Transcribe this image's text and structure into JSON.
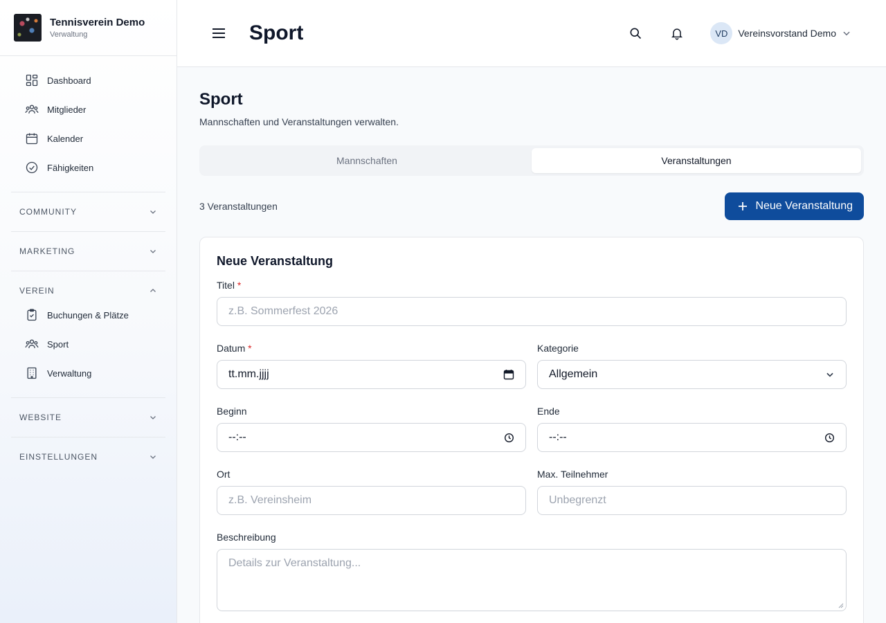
{
  "brand": {
    "title": "Tennisverein Demo",
    "subtitle": "Verwaltung"
  },
  "sidebar": {
    "main_items": [
      {
        "label": "Dashboard",
        "icon": "dashboard-icon"
      },
      {
        "label": "Mitglieder",
        "icon": "users-icon"
      },
      {
        "label": "Kalender",
        "icon": "calendar-icon"
      },
      {
        "label": "Fähigkeiten",
        "icon": "check-circle-icon"
      }
    ],
    "sections": {
      "community": "COMMUNITY",
      "marketing": "MARKETING",
      "verein": "VEREIN",
      "website": "WEBSITE",
      "einstellungen": "EINSTELLUNGEN"
    },
    "verein_items": [
      {
        "label": "Buchungen & Plätze",
        "icon": "clipboard-check-icon"
      },
      {
        "label": "Sport",
        "icon": "users-icon"
      },
      {
        "label": "Verwaltung",
        "icon": "building-icon"
      }
    ]
  },
  "header": {
    "title": "Sport",
    "user": {
      "initials": "VD",
      "name": "Vereinsvorstand Demo"
    }
  },
  "page": {
    "title": "Sport",
    "subtitle": "Mannschaften und Veranstaltungen verwalten.",
    "tabs": [
      {
        "label": "Mannschaften",
        "active": false
      },
      {
        "label": "Veranstaltungen",
        "active": true
      }
    ],
    "count_label": "3 Veranstaltungen",
    "new_button": "Neue Veranstaltung"
  },
  "form": {
    "title": "Neue Veranstaltung",
    "titel": {
      "label": "Titel",
      "required": "*",
      "placeholder": "z.B. Sommerfest 2026"
    },
    "datum": {
      "label": "Datum",
      "required": "*",
      "value": "tt.mm.jjjj"
    },
    "kategorie": {
      "label": "Kategorie",
      "value": "Allgemein"
    },
    "beginn": {
      "label": "Beginn",
      "value": "--:--"
    },
    "ende": {
      "label": "Ende",
      "value": "--:--"
    },
    "ort": {
      "label": "Ort",
      "placeholder": "z.B. Vereinsheim"
    },
    "max": {
      "label": "Max. Teilnehmer",
      "placeholder": "Unbegrenzt"
    },
    "beschreibung": {
      "label": "Beschreibung",
      "placeholder": "Details zur Veranstaltung..."
    }
  },
  "colors": {
    "primary": "#0f4c9c",
    "required": "#dc2626",
    "avatar_bg": "#dbe7f6"
  }
}
